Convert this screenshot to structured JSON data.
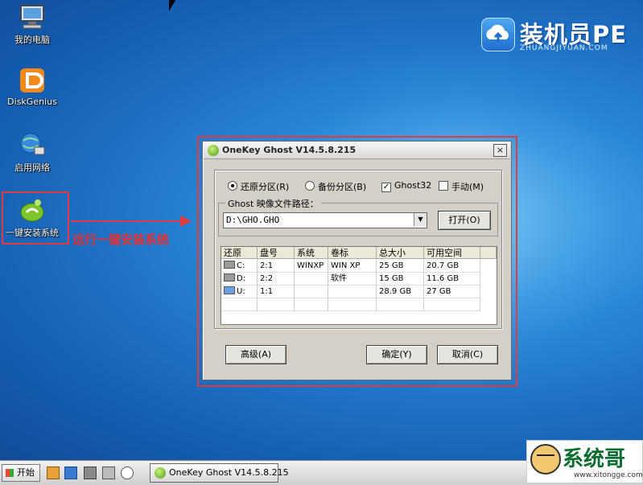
{
  "desktop": {
    "icons": [
      {
        "label": "我的电脑",
        "icon": "computer-icon"
      },
      {
        "label": "DiskGenius",
        "icon": "diskgenius-icon"
      },
      {
        "label": "启用网络",
        "icon": "network-icon"
      },
      {
        "label": "一键安装系统",
        "icon": "onekey-install-icon"
      }
    ],
    "logo": {
      "title": "装机员PE",
      "subtitle": "ZHUANGJIYUAN.COM"
    },
    "annotation": "运行一键安装系统"
  },
  "dialog": {
    "title": "OneKey Ghost V14.5.8.215",
    "close_glyph": "×",
    "options": {
      "restore": "还原分区(R)",
      "backup": "备份分区(B)",
      "ghost32": "Ghost32",
      "manual": "手动(M)"
    },
    "path_group": {
      "legend": "Ghost 映像文件路径：",
      "value": "D:\\GHO.GHO",
      "open_label": "打开(O)"
    },
    "table": {
      "columns": [
        "还原",
        "盘号",
        "系统",
        "卷标",
        "总大小",
        "可用空间"
      ],
      "rows": [
        {
          "drive": "C:",
          "disk": "2:1",
          "system": "WINXP",
          "label": "WIN XP",
          "size": "25 GB",
          "free": "20.7 GB"
        },
        {
          "drive": "D:",
          "disk": "2:2",
          "system": "",
          "label": "软件",
          "size": "15 GB",
          "free": "11.6 GB"
        },
        {
          "drive": "U:",
          "disk": "1:1",
          "system": "",
          "label": "",
          "size": "28.9 GB",
          "free": "27 GB"
        }
      ]
    },
    "buttons": {
      "advanced": "高级(A)",
      "ok": "确定(Y)",
      "cancel": "取消(C)"
    }
  },
  "taskbar": {
    "start_label": "开始",
    "task_label": "OneKey Ghost V14.5.8.215"
  },
  "watermark": {
    "name": "系统哥",
    "url": "www.xitongge.com"
  }
}
